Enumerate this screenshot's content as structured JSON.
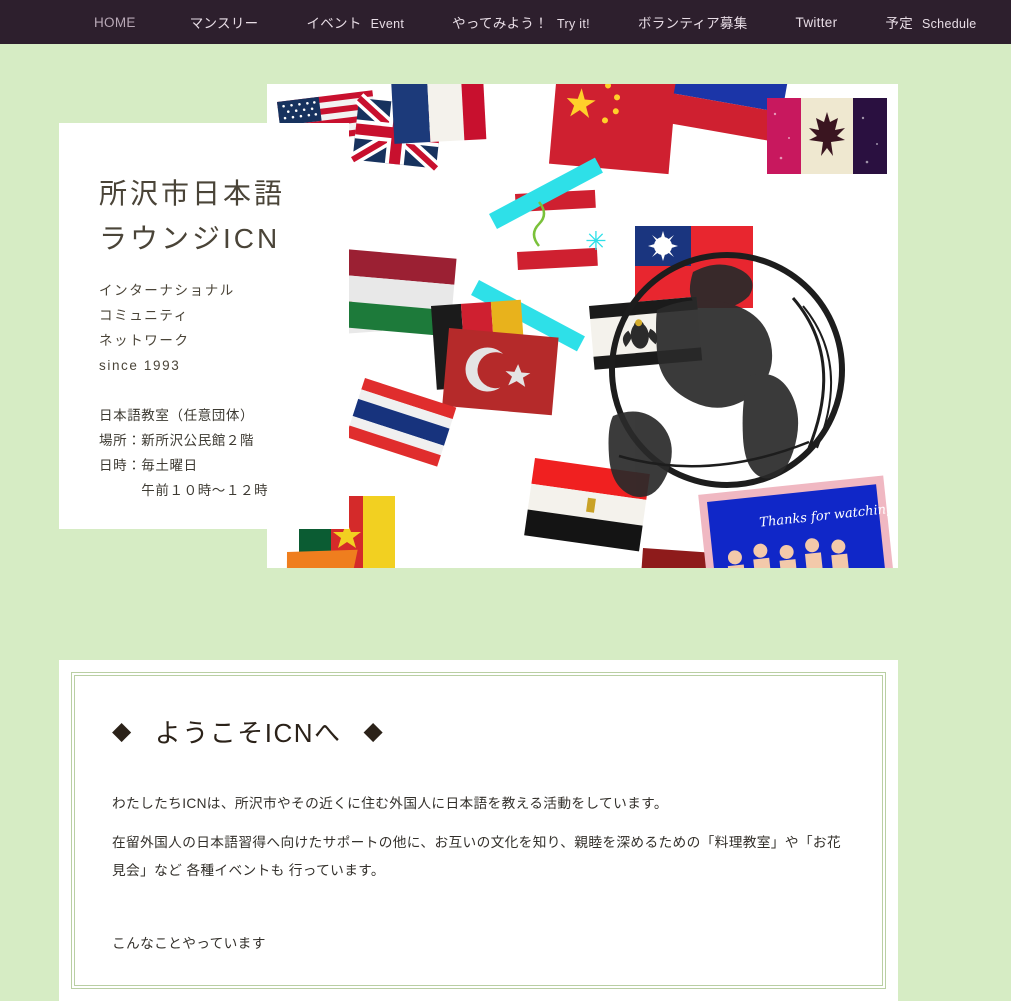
{
  "nav": {
    "items": [
      {
        "ja": "HOME",
        "en": "",
        "active": true
      },
      {
        "ja": "マンスリー",
        "en": ""
      },
      {
        "ja": "イベント",
        "en": "Event"
      },
      {
        "ja": "やってみよう！",
        "en": "Try it!"
      },
      {
        "ja": "ボランティア募集",
        "en": ""
      },
      {
        "ja": "Twitter",
        "en": ""
      },
      {
        "ja": "予定",
        "en": "Schedule"
      }
    ]
  },
  "intro": {
    "title": "所沢市日本語\nラウンジICN",
    "subtitle": "インターナショナル\nコミュニティ\nネットワーク\nsince 1993",
    "info": "日本語教室（任意団体）\n場所：新所沢公民館２階\n日時：毎土曜日\n　　　午前１０時〜１２時"
  },
  "hero": {
    "alt_caption": "Thanks for watching!"
  },
  "welcome": {
    "diamond_left": "◆",
    "diamond_right": "◆",
    "heading": "ようこそICNへ",
    "paragraph1": "わたしたちICNは、所沢市やその近くに住む外国人に日本語を教える活動をしています。",
    "paragraph2": "在留外国人の日本語習得へ向けたサポートの他に、お互いの文化を知り、親睦を深めるための「料理教室」や「お花見会」など 各種イベントも 行っています。",
    "paragraph3": "こんなことやっています"
  },
  "colors": {
    "page_background": "#d6ecc4",
    "nav_background": "#2d1f2d",
    "nav_text": "#e8dde6",
    "nav_text_active": "#b9a9b7",
    "card_background": "#ffffff",
    "heading_text": "#2b2219",
    "body_text": "#33302b",
    "title_text": "#4a4438",
    "inner_border": "#b9cfa3"
  }
}
